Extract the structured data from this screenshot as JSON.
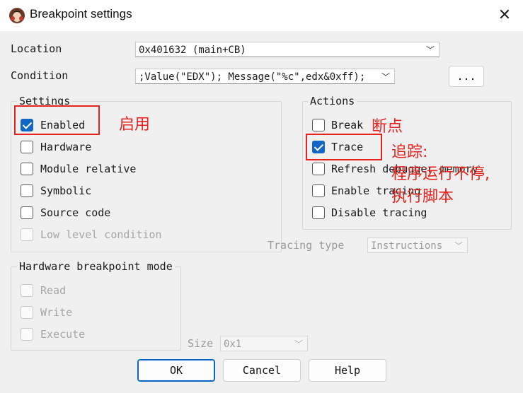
{
  "window": {
    "title": "Breakpoint settings"
  },
  "location": {
    "label": "Location",
    "value": "0x401632 (main+CB)"
  },
  "condition": {
    "label": "Condition",
    "value": ";Value(\"EDX\"); Message(\"%c\",edx&0xff);",
    "more_button": "..."
  },
  "settings": {
    "title": "Settings",
    "items": [
      {
        "label": "Enabled",
        "checked": true,
        "disabled": false
      },
      {
        "label": "Hardware",
        "checked": false,
        "disabled": false
      },
      {
        "label": "Module relative",
        "checked": false,
        "disabled": false
      },
      {
        "label": "Symbolic",
        "checked": false,
        "disabled": false
      },
      {
        "label": "Source code",
        "checked": false,
        "disabled": false
      },
      {
        "label": "Low level condition",
        "checked": false,
        "disabled": true
      }
    ]
  },
  "actions": {
    "title": "Actions",
    "items": [
      {
        "label": "Break",
        "checked": false
      },
      {
        "label": "Trace",
        "checked": true
      },
      {
        "label": "Refresh debugger memory",
        "checked": false
      },
      {
        "label": "Enable tracing",
        "checked": false
      },
      {
        "label": "Disable tracing",
        "checked": false
      }
    ]
  },
  "tracing_type": {
    "label": "Tracing type",
    "value": "Instructions"
  },
  "hardware_mode": {
    "title": "Hardware breakpoint mode",
    "items": [
      {
        "label": "Read",
        "checked": false
      },
      {
        "label": "Write",
        "checked": false
      },
      {
        "label": "Execute",
        "checked": false
      }
    ]
  },
  "size": {
    "label": "Size",
    "value": "0x1"
  },
  "buttons": {
    "ok": "OK",
    "cancel": "Cancel",
    "help": "Help"
  },
  "annotations": {
    "enabled_note": "启用",
    "break_note": "断点",
    "trace_note_line1": "追踪:",
    "trace_note_line2": "程序运行不停,",
    "trace_note_line3": "执行脚本"
  },
  "colors": {
    "accent": "#1167c3",
    "annotation_red": "#e8231f"
  }
}
